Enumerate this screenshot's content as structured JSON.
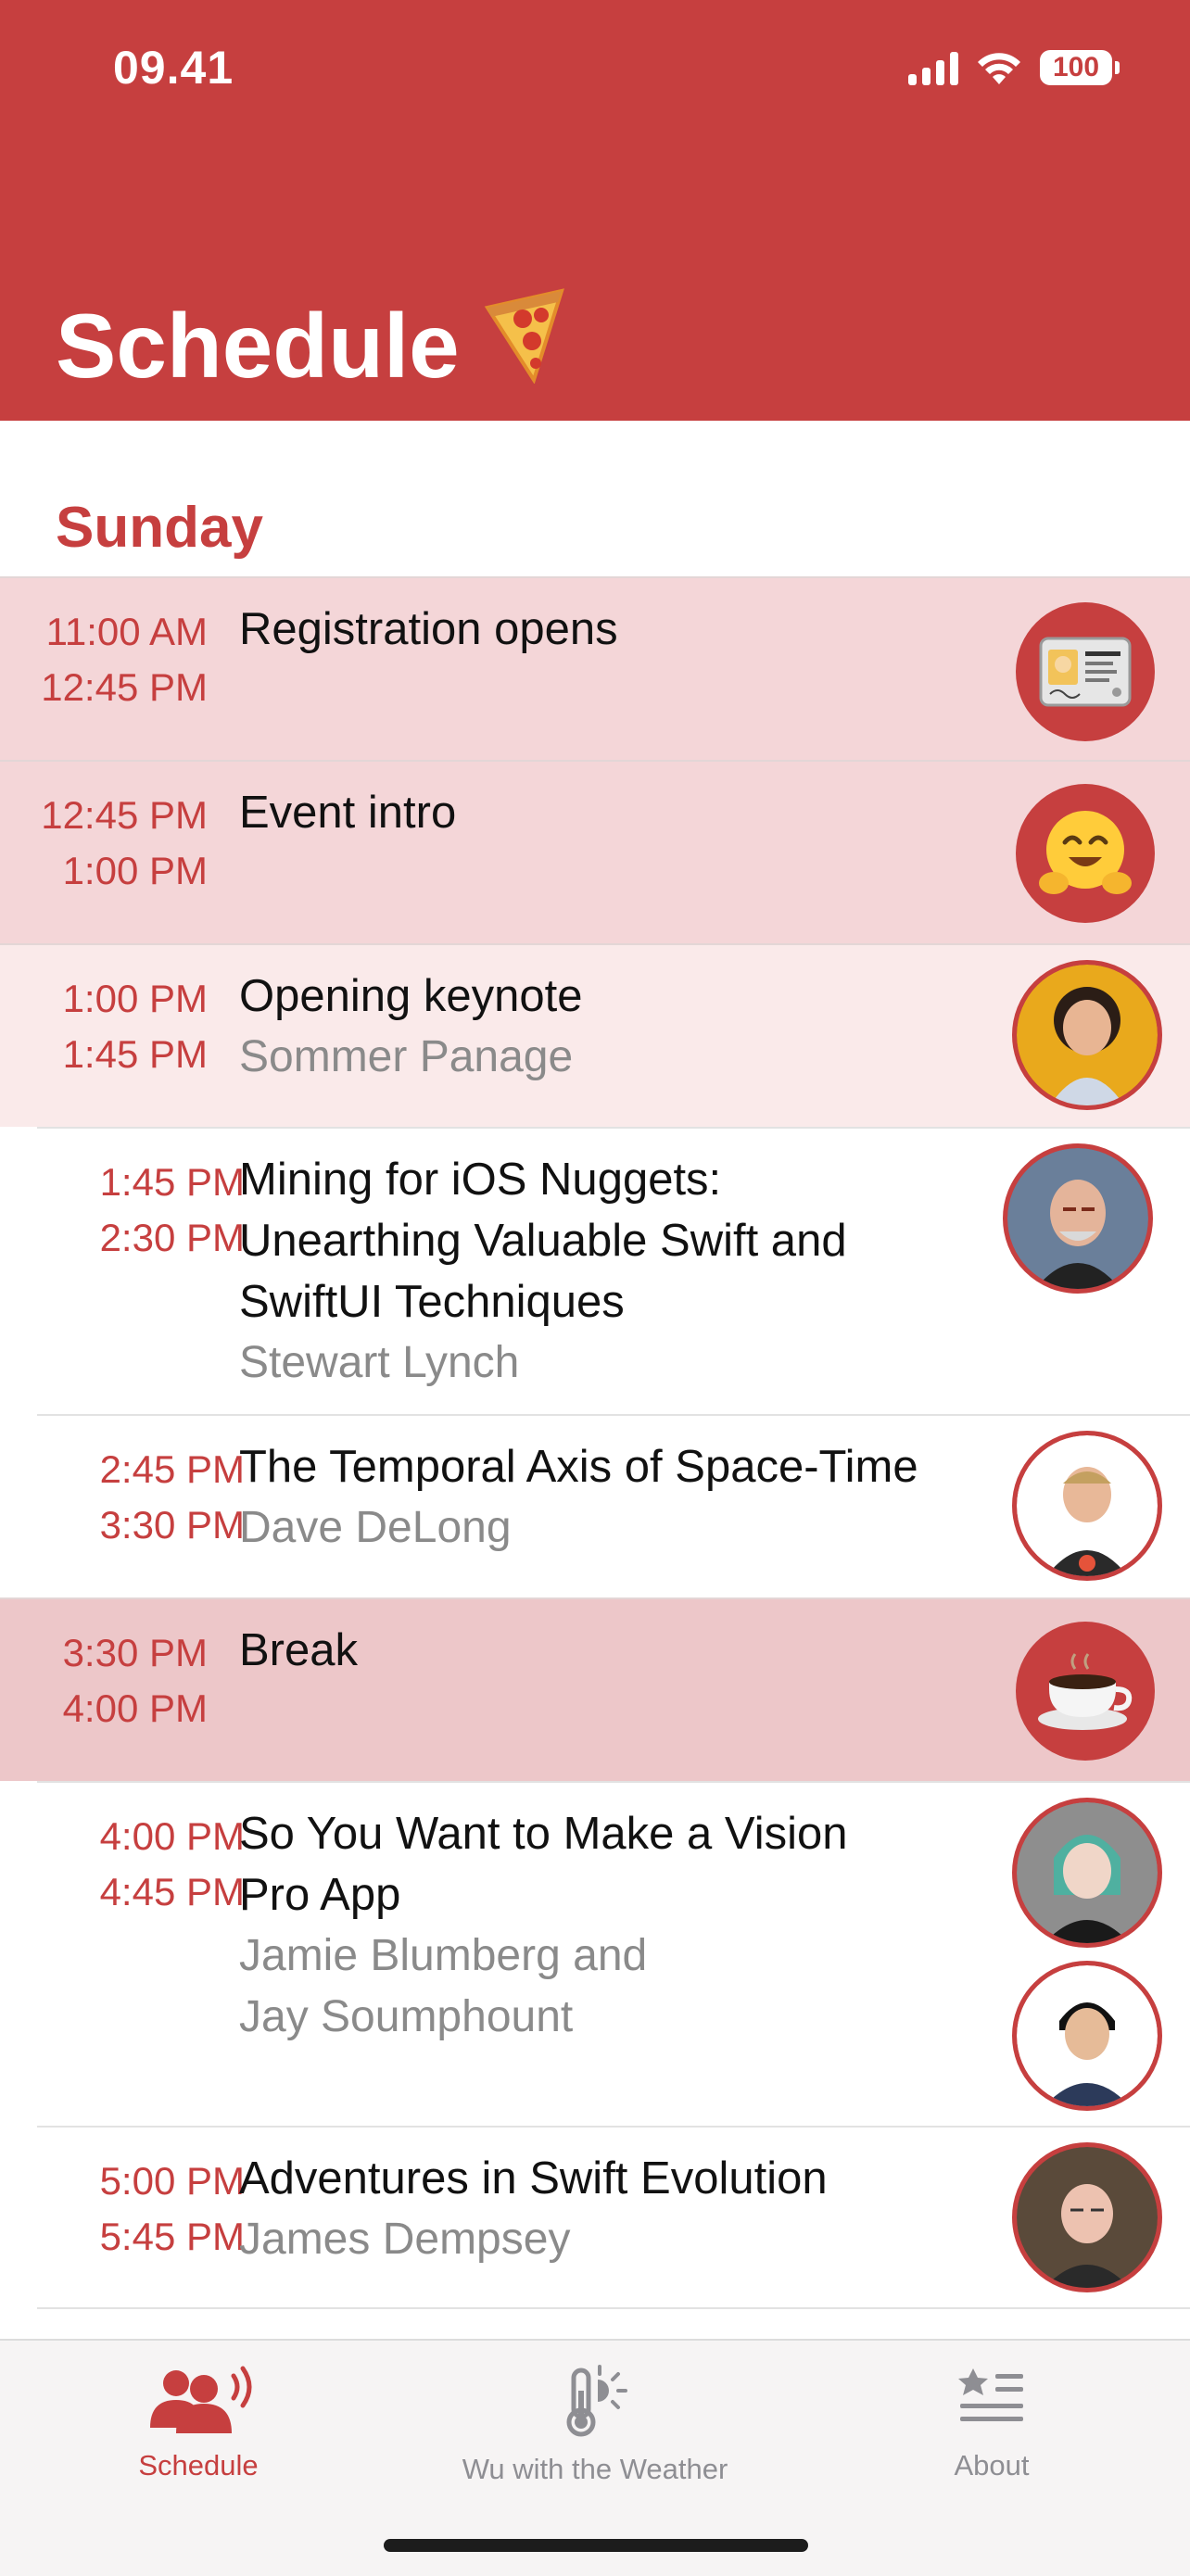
{
  "status_bar": {
    "time": "09.41",
    "battery": "100"
  },
  "header": {
    "title": "Schedule",
    "title_emoji": "🍕"
  },
  "colors": {
    "accent": "#c63f3f",
    "row_highlight": "#f4d6d8",
    "row_light": "#faeaea",
    "row_break": "#edc7c9"
  },
  "day": "Sunday",
  "sessions": [
    {
      "start": "11:00 AM",
      "end": "12:45 PM",
      "title_lines": [
        "Registration opens"
      ],
      "speaker_lines": [],
      "icon": "id-badge-icon",
      "emoji": "🪪"
    },
    {
      "start": "12:45 PM",
      "end": "1:00 PM",
      "title_lines": [
        "Event intro"
      ],
      "speaker_lines": [],
      "icon": "hugging-face-icon",
      "emoji": "🤗"
    },
    {
      "start": "1:00 PM",
      "end": "1:45 PM",
      "title_lines": [
        "Opening keynote"
      ],
      "speaker_lines": [
        "Sommer Panage"
      ],
      "icon": "speaker-photo"
    },
    {
      "start": "1:45 PM",
      "end": "2:30 PM",
      "title_lines": [
        "Mining for iOS Nuggets:",
        "Unearthing Valuable Swift and",
        "SwiftUI Techniques"
      ],
      "speaker_lines": [
        "Stewart Lynch"
      ],
      "icon": "speaker-photo"
    },
    {
      "start": "2:45 PM",
      "end": "3:30 PM",
      "title_lines": [
        "The Temporal Axis of Space-Time"
      ],
      "speaker_lines": [
        "Dave DeLong"
      ],
      "icon": "speaker-photo"
    },
    {
      "start": "3:30 PM",
      "end": "4:00 PM",
      "title_lines": [
        "Break"
      ],
      "speaker_lines": [],
      "icon": "coffee-icon",
      "emoji": "☕"
    },
    {
      "start": "4:00 PM",
      "end": "4:45 PM",
      "title_lines": [
        "So You Want to Make a Vision",
        "Pro App"
      ],
      "speaker_lines": [
        "Jamie Blumberg and",
        "Jay Soumphount"
      ],
      "icon": "speaker-photo"
    },
    {
      "start": "5:00 PM",
      "end": "5:45 PM",
      "title_lines": [
        "Adventures in Swift Evolution"
      ],
      "speaker_lines": [
        "James Dempsey"
      ],
      "icon": "speaker-photo"
    }
  ],
  "tabs": [
    {
      "label": "Schedule",
      "icon": "people-broadcast-icon",
      "active": true
    },
    {
      "label": "Wu with the Weather",
      "icon": "thermometer-sun-icon",
      "active": false
    },
    {
      "label": "About",
      "icon": "star-list-icon",
      "active": false
    }
  ]
}
